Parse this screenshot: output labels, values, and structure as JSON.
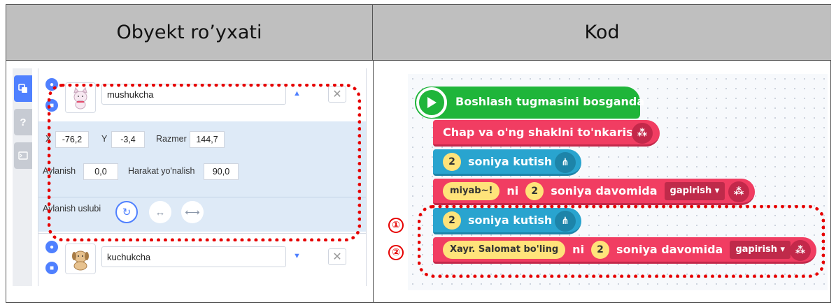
{
  "headers": {
    "left": "Obyekt ro’yxati",
    "right": "Kod"
  },
  "sidebar": {
    "tabs": [
      {
        "name": "objects",
        "icon": "shapes-icon"
      },
      {
        "name": "help",
        "label": "?"
      },
      {
        "name": "console",
        "icon": "console-icon"
      }
    ]
  },
  "objects": [
    {
      "name": "mushukcha",
      "expanded": true,
      "props": {
        "x_label": "X",
        "x_value": "-76,2",
        "y_label": "Y",
        "y_value": "-3,4",
        "size_label": "Razmer",
        "size_value": "144,7",
        "rotation_label": "Aylanish",
        "rotation_value": "0,0",
        "direction_label": "Harakat yo'nalish",
        "direction_value": "90,0",
        "rotation_style_label": "Aylanish uslubi"
      }
    },
    {
      "name": "kuchukcha",
      "expanded": false
    }
  ],
  "code": {
    "start_block": "Boshlash tugmasini bosganda",
    "blocks": [
      {
        "text": "Chap va o'ng shaklni to'nkarish"
      },
      {
        "num": "2",
        "text": "soniya kutish"
      },
      {
        "say": "miyab~!",
        "ni": "ni",
        "num": "2",
        "text": "soniya davomida",
        "dropdown": "gapirish"
      },
      {
        "num": "2",
        "text": "soniya kutish"
      },
      {
        "say": "Xayr. Salomat bo'ling",
        "ni": "ni",
        "num": "2",
        "text": "soniya davomida",
        "dropdown": "gapirish"
      }
    ],
    "markers": [
      "①",
      "②"
    ]
  },
  "colors": {
    "looks": "#f13d62",
    "flow": "#29a4cf",
    "start": "#1fb53a",
    "highlight": "#e60000"
  }
}
